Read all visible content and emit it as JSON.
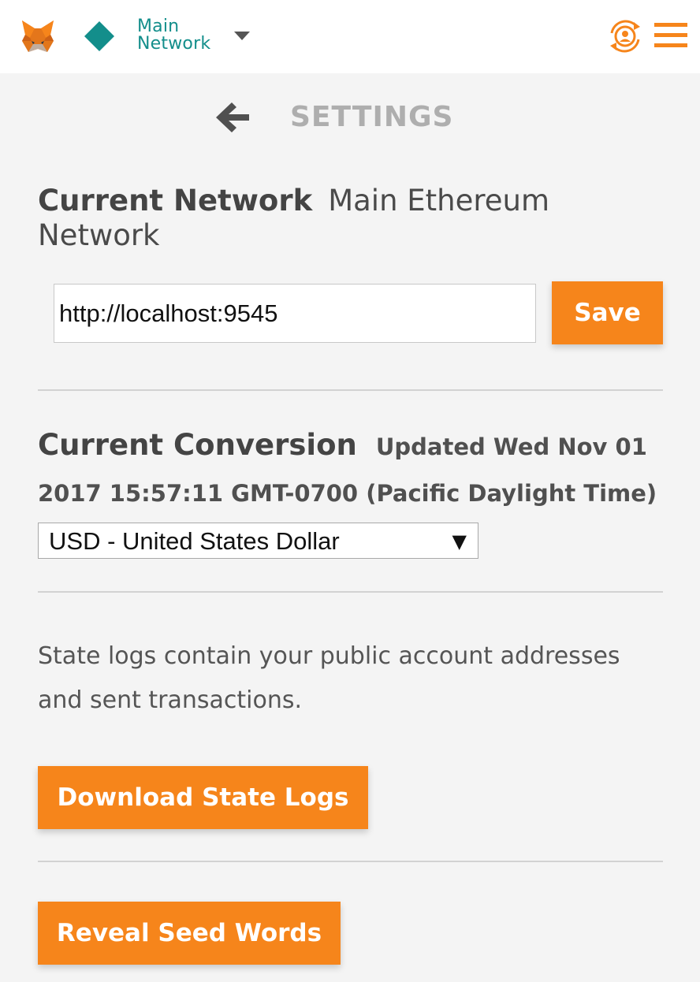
{
  "header": {
    "network_line1": "Main",
    "network_line2": "Network",
    "colors": {
      "accent": "#f6851b",
      "network": "#138e8b"
    },
    "icons": [
      "metamask-fox-logo",
      "network-diamond-icon",
      "caret-down-icon",
      "account-switch-icon",
      "hamburger-menu-icon"
    ]
  },
  "page": {
    "title": "SETTINGS",
    "back_icon": "arrow-left-icon"
  },
  "network": {
    "heading": "Current Network",
    "value": "Main Ethereum Network",
    "rpc_value": "http://localhost:9545",
    "save_label": "Save"
  },
  "conversion": {
    "heading": "Current Conversion",
    "updated_line1": "Updated Wed Nov 01",
    "updated_line2": "2017 15:57:11 GMT-0700 (Pacific Daylight Time)",
    "selected": "USD - United States Dollar",
    "arrow": "▼"
  },
  "state_logs": {
    "description": "State logs contain your public account addresses and sent transactions.",
    "download_label": "Download State Logs"
  },
  "seed": {
    "reveal_label": "Reveal Seed Words"
  }
}
